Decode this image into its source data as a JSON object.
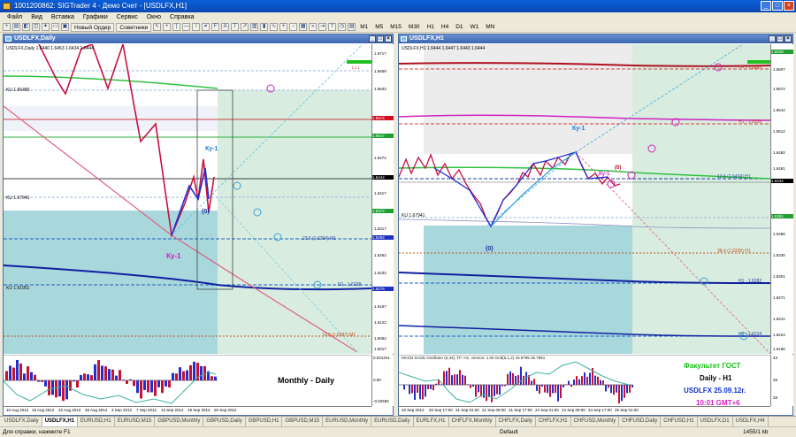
{
  "app_title": "1001200862: SIGTrader 4 - Демо Счет - [USDLFX,H1]",
  "menu": [
    "Файл",
    "Вид",
    "Вставка",
    "Графики",
    "Сервис",
    "Окно",
    "Справка"
  ],
  "toolbar": {
    "new_order": "Новый Ордер",
    "advisors": "Советники",
    "timeframes": [
      "M1",
      "M5",
      "M15",
      "M30",
      "H1",
      "H4",
      "D1",
      "W1",
      "MN"
    ]
  },
  "left_chart": {
    "title": "USDLFX,Daily",
    "info": "USDLFX,Daily 1.6440 1.6453 1.6434 1.6444",
    "ku_top": "KU 1.66480",
    "ku_mid": "KU 1.67941",
    "ku_low": "KU 1.61951",
    "label_ky": "Ку-1",
    "label_ky2": "Ку-1",
    "label_zero": "(0)",
    "label_level1": "23.6 (1.6294) M1",
    "label_level2": "D1 - 1.6238",
    "label_level3": "13.6 (1.6087) M1",
    "caption": "Monthly - Daily",
    "prices": [
      "1.6717",
      "1.6659",
      "1.6633",
      "1.6574",
      "1.6517",
      "1.6472",
      "1.6444",
      "1.6417",
      "1.6372",
      "1.6317",
      "1.6294",
      "1.6262",
      "1.6232",
      "1.6176",
      "1.6157",
      "1.6122",
      "1.6062",
      "1.6017"
    ],
    "dates": [
      "10 Aug 2012",
      "16 Aug 2012",
      "22 Aug 2012",
      "28 Aug 2012",
      "3 Sep 2012",
      "7 Sep 2012",
      "13 Sep 2012",
      "19 Sep 2012",
      "25 Sep 2012"
    ],
    "osc_vals": [
      "0.021341",
      "0.00",
      "-0.02592"
    ]
  },
  "right_chart": {
    "title": "USDLFX,H1",
    "info": "USDLFX,H1 1.6444 1.6447 1.6443 1.6444",
    "ku": "KU 1.67941",
    "label_ky": "Ку-1",
    "label_ky2": "Ку-1",
    "label_zero": "(0)",
    "label_zero2": "(0)",
    "label_h1_top": "H1 - 1.6624",
    "label_h1_mid": "H1 - 1.6536",
    "label_h1_low": "H1 - 1.6282",
    "label_h1_bottom": "H1 - 1.6224",
    "label_level1": "13.6 (1.6434) H1",
    "label_level2": "38.4 (1.6339) H1",
    "prices": [
      "1.6628",
      "1.6607",
      "1.6572",
      "1.6542",
      "1.6512",
      "1.6482",
      "1.6461",
      "1.6444",
      "1.6391",
      "1.6366",
      "1.6330",
      "1.6301",
      "1.6271",
      "1.6241",
      "1.6224",
      "1.6196"
    ],
    "dates": [
      "20 Sep 2012",
      "20 Sep 17:00",
      "21 Sep 01:00",
      "21 Sep 09:00",
      "21 Sep 17:00",
      "24 Sep 01:00",
      "24 Sep 09:00",
      "24 Sep 17:00",
      "25 Sep 01:00"
    ],
    "osc_title": "MACD SAGE Oscillator (5,34), TF: H1, version: 1.00   Grid(5,1,2) 43.8795 35.7951",
    "osc_vals": [
      "43",
      "25",
      "28"
    ],
    "faculty": "Факультет ГОСТ",
    "tf_label": "Daily - H1",
    "symbol_date": "USDLFX 25.09.12г.",
    "time_label": "10:01  GMT+6"
  },
  "tabs": [
    "USDLFX,Daily",
    "USDLFX,H1",
    "EURUSD,H1",
    "EURUSD,M15",
    "GBPUSD,Monthly",
    "GBPUSD,Daily",
    "GBPUSD,H1",
    "GBPUSD,M15",
    "EURUSD,Monthly",
    "EURUSD,Daily",
    "EURLFX,H1",
    "CHFLFX,Monthly",
    "CHFLFX,Daily",
    "CHFLFX,H1",
    "CHFUSD,Monthly",
    "CHFUSD,Daily",
    "CHFUSD,H1",
    "USDLFX,D1",
    "USDLFX,H4"
  ],
  "status": {
    "help": "Для справки, нажмите F1",
    "profile": "Default",
    "traffic": "1455/1 kb"
  },
  "colors": {
    "title_blue": "#0b48b4",
    "kumo_light": "#d8ede0",
    "kumo_dark": "#a8d8dc",
    "red": "#cc0033",
    "blue": "#1030d0",
    "green": "#10c010",
    "magenta": "#d020c0"
  }
}
